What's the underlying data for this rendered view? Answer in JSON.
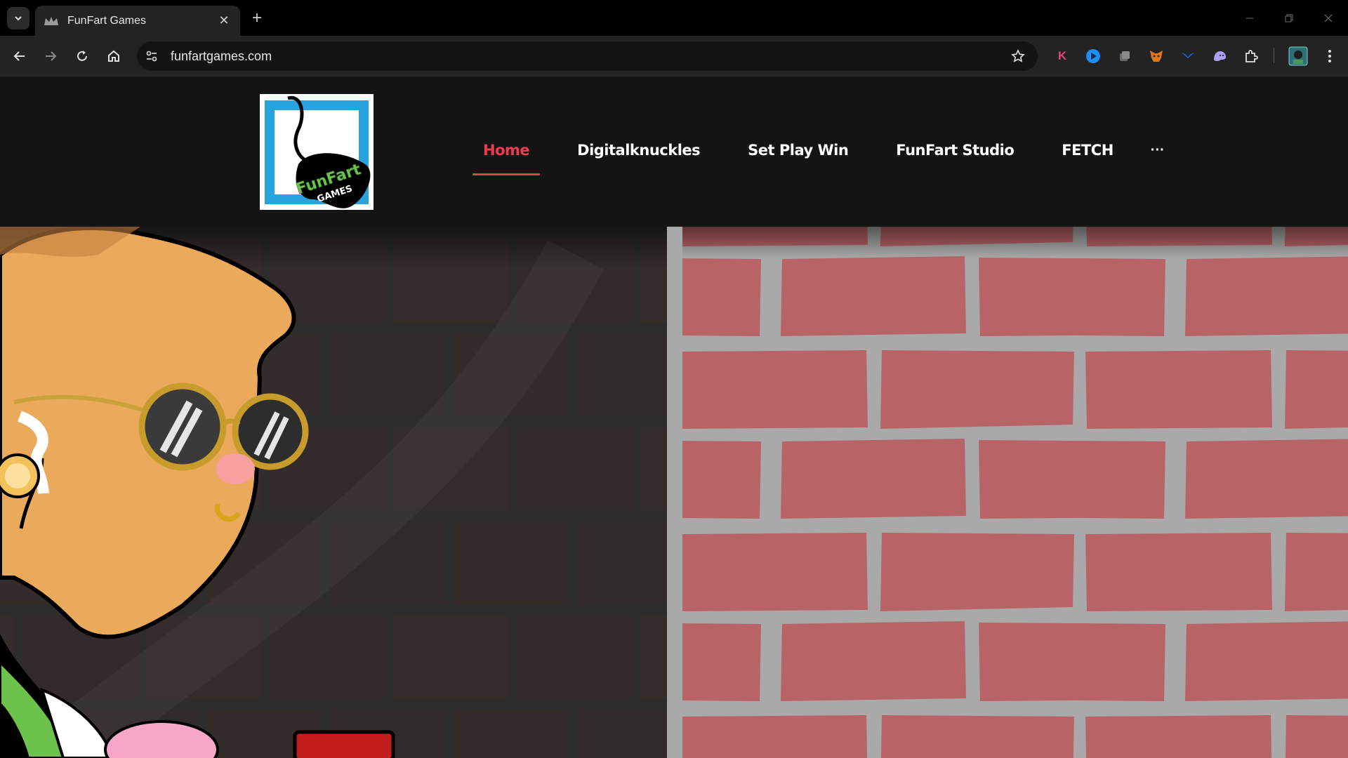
{
  "browser": {
    "tab": {
      "title": "FunFart Games"
    },
    "url": "funfartgames.com",
    "icons": [
      "tab-search-icon",
      "new-tab-icon",
      "back-icon",
      "forward-icon",
      "reload-icon",
      "home-icon",
      "site-info-icon",
      "bookmark-star-icon",
      "kaspersky-icon",
      "extension-blue-icon",
      "extension-grey-icon",
      "metamask-icon",
      "extension-bird-icon",
      "extension-ghost-icon",
      "extensions-puzzle-icon",
      "profile-avatar-icon",
      "menu-dots-icon"
    ]
  },
  "site": {
    "logo": {
      "line1": "FunFart",
      "line2": "GAMES"
    },
    "nav": [
      {
        "label": "Home",
        "active": true
      },
      {
        "label": "Digitalknuckles"
      },
      {
        "label": "Set Play Win"
      },
      {
        "label": "FunFart Studio"
      },
      {
        "label": "FETCH"
      }
    ],
    "nav_more": "···"
  },
  "colors": {
    "accent": "#ef3b4d",
    "brick": "#b86367",
    "mortar": "#a9a9a9",
    "dark_wall": "#2c2b2b"
  }
}
